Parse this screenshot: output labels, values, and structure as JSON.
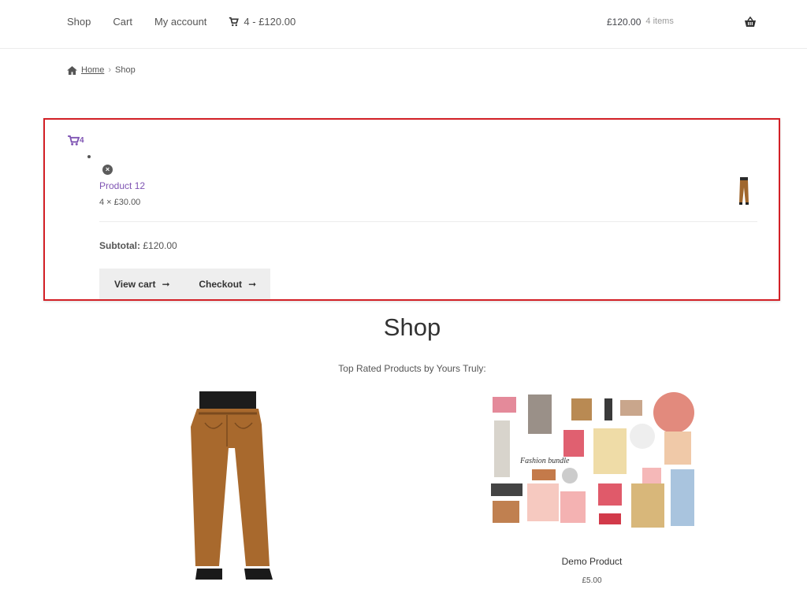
{
  "header": {
    "nav": [
      "Shop",
      "Cart",
      "My account"
    ],
    "cart_link": "4 - £120.00",
    "mini_total": "£120.00",
    "mini_count": "4 items"
  },
  "breadcrumb": {
    "home": "Home",
    "sep": "›",
    "current": "Shop"
  },
  "widget": {
    "cart_count": "4",
    "item": {
      "name": "Product 12",
      "qty_price": "4 × £30.00",
      "remove_symbol": "×"
    },
    "subtotal_label": "Subtotal:",
    "subtotal_value": "£120.00",
    "view_cart": "View cart",
    "checkout": "Checkout",
    "arrow": "➞"
  },
  "page": {
    "title": "Shop",
    "subtitle": "Top Rated Products by Yours Truly:"
  },
  "products": [
    {
      "name": "Demo Product",
      "price": "£5.00"
    }
  ],
  "colors": {
    "accent": "#7f54b3",
    "highlight": "#d32026"
  }
}
